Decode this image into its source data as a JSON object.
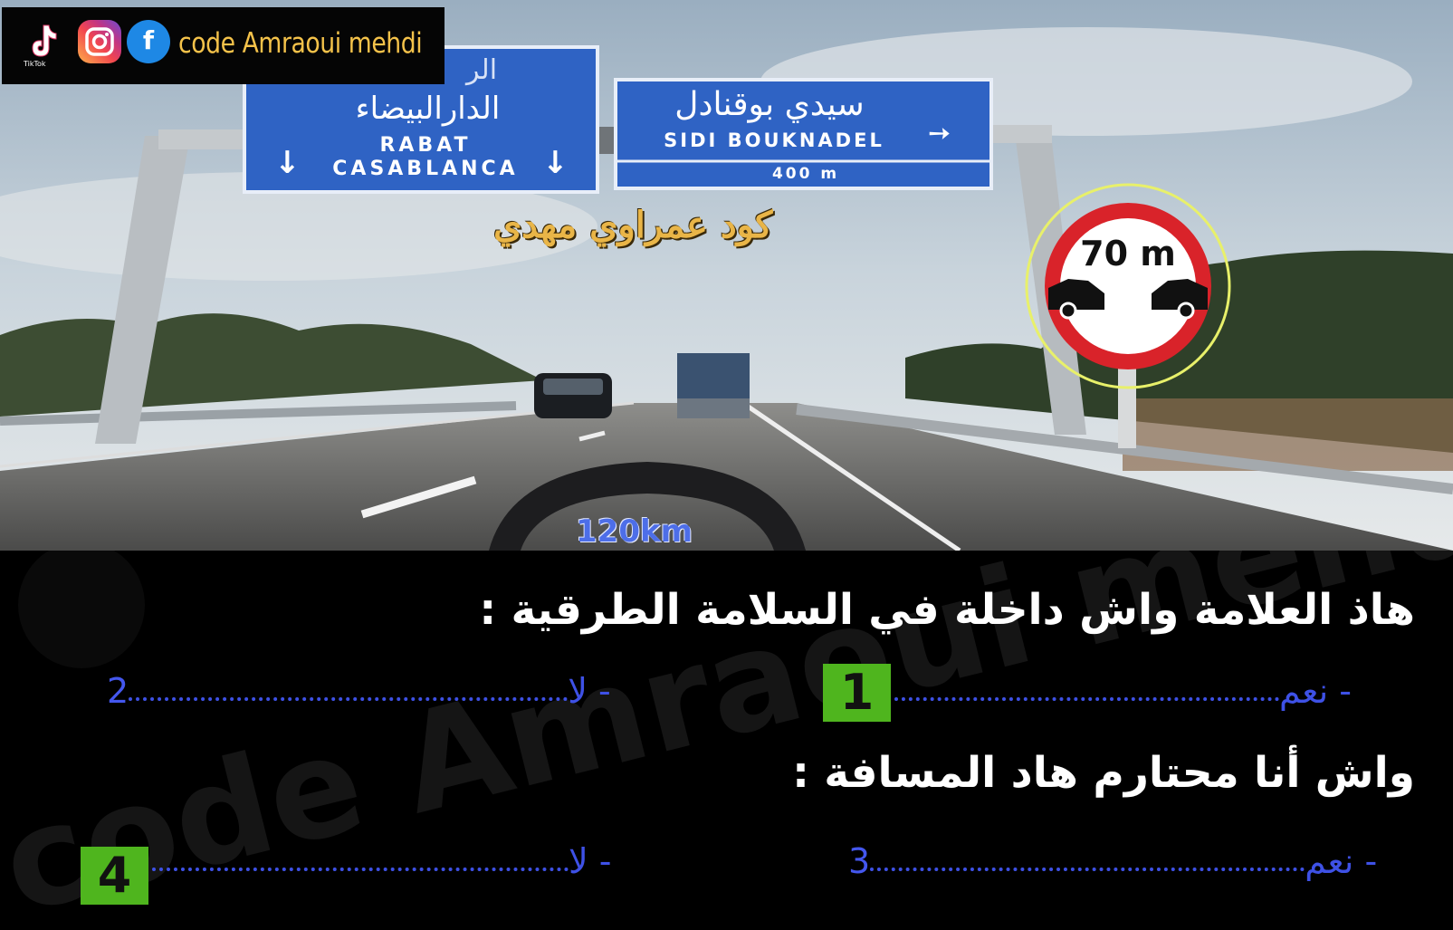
{
  "social": {
    "icons": [
      "tiktok-icon",
      "instagram-icon",
      "facebook-icon"
    ],
    "tiktok_caption": "TikTok",
    "facebook_glyph": "f",
    "channel_name": "code Amraoui mehdi"
  },
  "highway": {
    "left_sign": {
      "top_partial": "الر",
      "arabic": "الدارالبيضاء",
      "latin_1": "RABAT",
      "latin_2": "CASABLANCA",
      "arrows": [
        "↓",
        "↓"
      ]
    },
    "right_sign": {
      "arabic": "سيدي بوقنادل",
      "latin": "SIDI BOUKNADEL",
      "distance": "400 m"
    }
  },
  "overlay": {
    "watermark_ar": "كود عمراوي مهدي",
    "speed": "120km",
    "distance_sign_value": "70 m",
    "background_watermark": "code Amraoui mehdi"
  },
  "quiz": {
    "question_1": "هاذ العلامة واش داخلة في السلامة الطرقية :",
    "question_2": "واش أنا محتارم هاد المسافة :",
    "q1_answers": [
      {
        "label": "- نعم",
        "number": "1",
        "highlighted": true
      },
      {
        "label": "- لا",
        "number": "2",
        "highlighted": false
      }
    ],
    "q2_answers": [
      {
        "label": "- نعم",
        "number": "3",
        "highlighted": false
      },
      {
        "label": "- لا",
        "number": "4",
        "highlighted": true
      }
    ]
  },
  "colors": {
    "answer_blue": "#3e51e6",
    "badge_green": "#4fb51e",
    "sign_blue": "#2f63c4",
    "watermark_gold": "#e9b547"
  }
}
